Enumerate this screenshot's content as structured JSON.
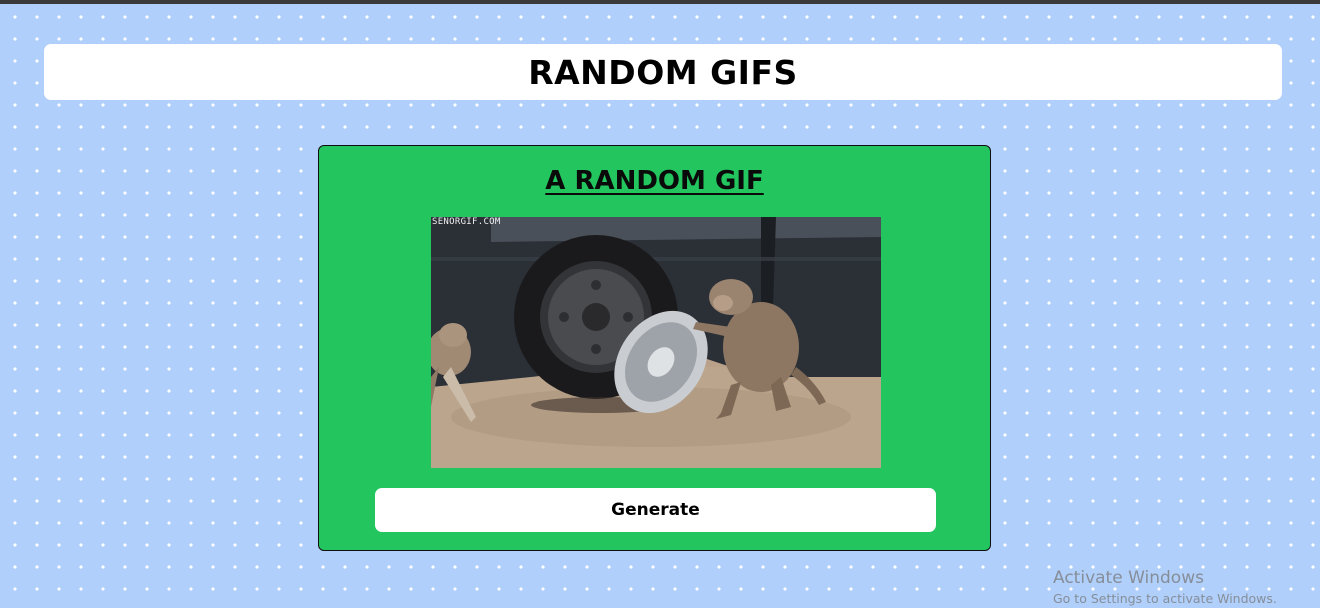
{
  "header": {
    "title": "RANDOM GIFS"
  },
  "card": {
    "title": "A RANDOM GIF",
    "gif": {
      "watermark": "SENORGIF.COM"
    },
    "generate_label": "Generate"
  },
  "os_watermark": {
    "line1": "Activate Windows",
    "line2": "Go to Settings to activate Windows."
  },
  "colors": {
    "background": "#b0cffa",
    "card": "#22c55e",
    "button": "#ffffff",
    "header": "#ffffff"
  }
}
